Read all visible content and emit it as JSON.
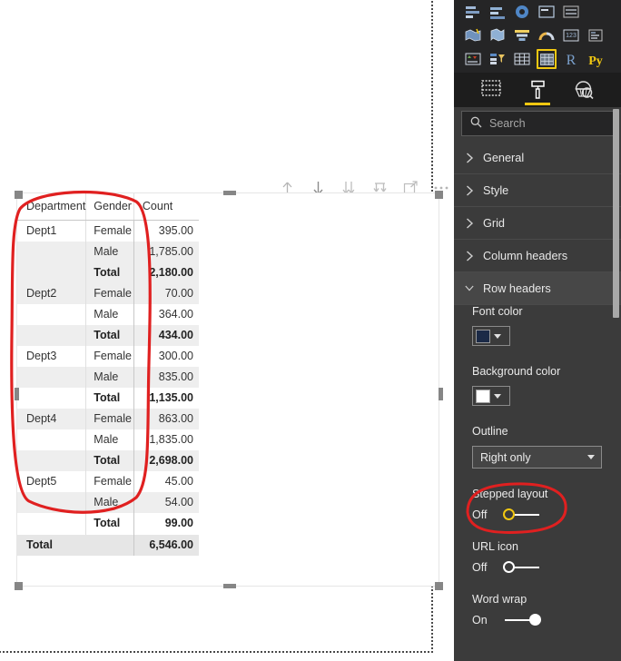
{
  "visual": {
    "type": "matrix",
    "columns": [
      "Department",
      "Gender",
      "Count"
    ],
    "rows": [
      {
        "dept": "Dept1",
        "gender": "Female",
        "count": "395.00",
        "band": false,
        "total": false
      },
      {
        "dept": "",
        "gender": "Male",
        "count": "1,785.00",
        "band": true,
        "total": false
      },
      {
        "dept": "",
        "gender": "Total",
        "count": "2,180.00",
        "band": true,
        "total": true
      },
      {
        "dept": "Dept2",
        "gender": "Female",
        "count": "70.00",
        "band": true,
        "total": false
      },
      {
        "dept": "",
        "gender": "Male",
        "count": "364.00",
        "band": false,
        "total": false
      },
      {
        "dept": "",
        "gender": "Total",
        "count": "434.00",
        "band": true,
        "total": true
      },
      {
        "dept": "Dept3",
        "gender": "Female",
        "count": "300.00",
        "band": false,
        "total": false
      },
      {
        "dept": "",
        "gender": "Male",
        "count": "835.00",
        "band": true,
        "total": false
      },
      {
        "dept": "",
        "gender": "Total",
        "count": "1,135.00",
        "band": false,
        "total": true
      },
      {
        "dept": "Dept4",
        "gender": "Female",
        "count": "863.00",
        "band": true,
        "total": false
      },
      {
        "dept": "",
        "gender": "Male",
        "count": "1,835.00",
        "band": false,
        "total": false
      },
      {
        "dept": "",
        "gender": "Total",
        "count": "2,698.00",
        "band": true,
        "total": true
      },
      {
        "dept": "Dept5",
        "gender": "Female",
        "count": "45.00",
        "band": false,
        "total": false
      },
      {
        "dept": "",
        "gender": "Male",
        "count": "54.00",
        "band": true,
        "total": false
      },
      {
        "dept": "",
        "gender": "Total",
        "count": "99.00",
        "band": false,
        "total": true
      }
    ],
    "grand_total": {
      "label": "Total",
      "count": "6,546.00"
    }
  },
  "drill_toolbar": {
    "buttons": [
      {
        "name": "drill-up",
        "tooltip": "Drill up"
      },
      {
        "name": "drill-down",
        "tooltip": "Drill down"
      },
      {
        "name": "expand-all-down",
        "tooltip": "Expand all down one level"
      },
      {
        "name": "go-to-next-level",
        "tooltip": "Go to the next level in the hierarchy"
      },
      {
        "name": "focus-mode",
        "tooltip": "Focus mode"
      },
      {
        "name": "more-options",
        "tooltip": "More options"
      }
    ]
  },
  "annotations": [
    {
      "name": "row-headers-highlight",
      "shape": "ellipse",
      "color": "#e02020"
    },
    {
      "name": "stepped-layout-highlight",
      "shape": "ellipse",
      "color": "#e02020"
    }
  ],
  "panel": {
    "gallery": {
      "selected": "matrix-visual-icon",
      "rows": [
        [
          "stacked-bar-chart-icon",
          "clustered-bar-chart-icon",
          "donut-chart-icon",
          "card-icon",
          "multi-row-card-icon"
        ],
        [
          "filled-map-icon",
          "shape-map-icon",
          "funnel-icon",
          "gauge-icon",
          "card-number-icon",
          "multi-row-card-2-icon"
        ],
        [
          "kpi-icon",
          "slicer-icon",
          "table-icon",
          "matrix-visual-icon",
          "r-script-visual-icon",
          "python-visual-icon"
        ],
        [
          "arcgis-maps-icon",
          "more-visuals-icon"
        ]
      ]
    },
    "tabs": [
      {
        "name": "fields-tab",
        "icon": "fields-icon",
        "active": false
      },
      {
        "name": "format-tab",
        "icon": "paint-roller-icon",
        "active": true
      },
      {
        "name": "analytics-tab",
        "icon": "analytics-magnifier-icon",
        "active": false
      }
    ],
    "search": {
      "placeholder": "Search",
      "value": ""
    },
    "sections": [
      {
        "label": "General",
        "open": false
      },
      {
        "label": "Style",
        "open": false
      },
      {
        "label": "Grid",
        "open": false
      },
      {
        "label": "Column headers",
        "open": false
      },
      {
        "label": "Row headers",
        "open": true
      }
    ],
    "row_headers": {
      "font_color": {
        "label": "Font color",
        "value": "#1b2a47"
      },
      "background_color": {
        "label": "Background color",
        "value": "#ffffff"
      },
      "outline": {
        "label": "Outline",
        "value": "Right only"
      },
      "stepped_layout": {
        "label": "Stepped layout",
        "state": "Off",
        "on": false
      },
      "url_icon": {
        "label": "URL icon",
        "state": "Off",
        "on": false
      },
      "word_wrap": {
        "label": "Word wrap",
        "state": "On",
        "on": true
      }
    }
  },
  "colors": {
    "accent_yellow": "#f2c811",
    "panel_bg": "#3b3b3b",
    "gallery_bg": "#252526",
    "tabs_bg": "#1d1d1d",
    "annotation_red": "#e02020",
    "row_band": "#eeeeee"
  }
}
